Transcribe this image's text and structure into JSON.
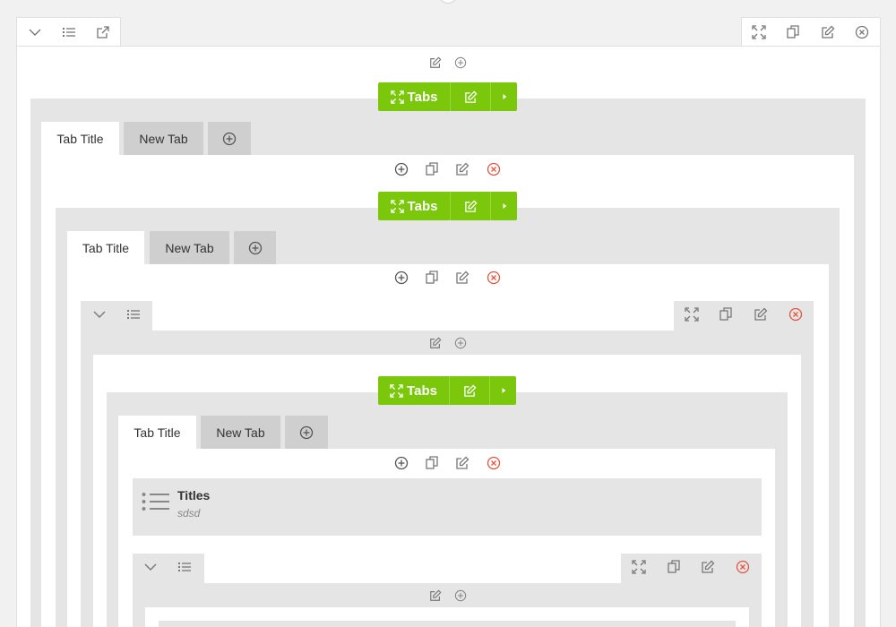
{
  "tabs_widget": {
    "label": "Tabs"
  },
  "tab_labels": {
    "first": "Tab Title",
    "second": "New Tab"
  },
  "titles_element": {
    "title": "Titles",
    "subtitle": "sdsd"
  },
  "colors": {
    "accent": "#7ac70c",
    "danger": "#e2563f",
    "icon": "#777777",
    "panel": "#e5e5e5"
  },
  "icons": [
    "chevron-down-icon",
    "list-icon",
    "export-icon",
    "fullscreen-icon",
    "copy-icon",
    "edit-icon",
    "close-circle-icon",
    "add-circle-icon",
    "caret-right-icon"
  ]
}
